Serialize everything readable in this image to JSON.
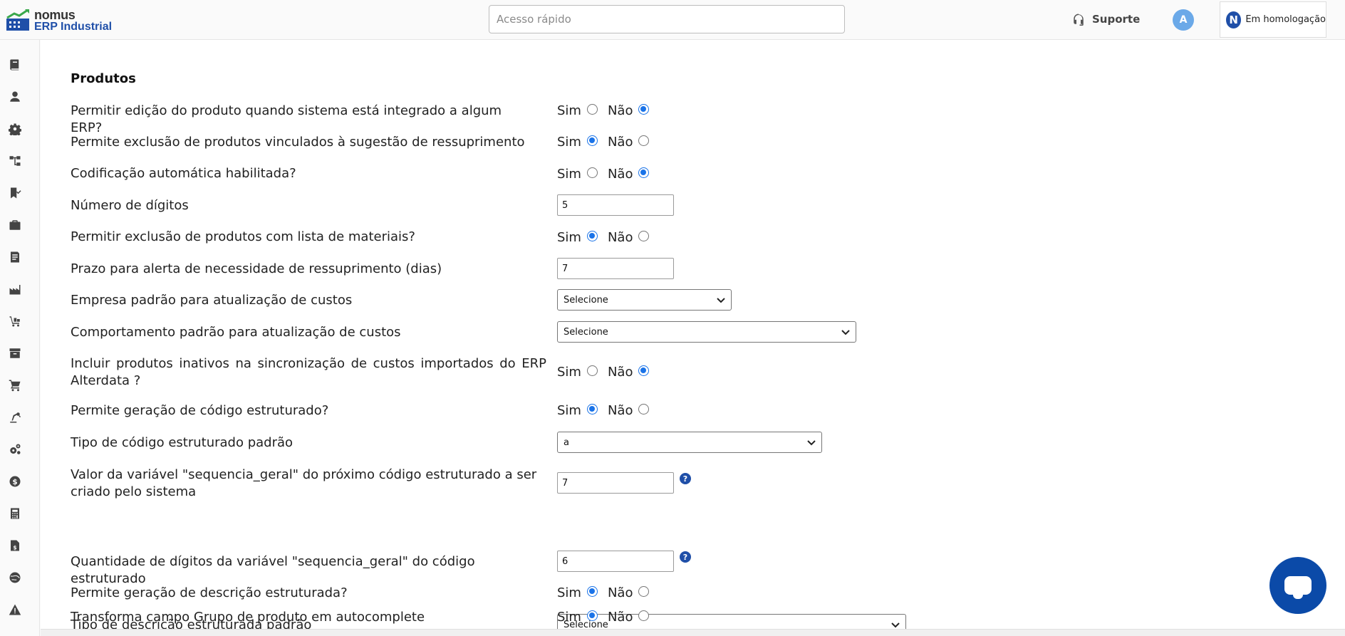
{
  "header": {
    "logo_name": "nomus",
    "logo_sub": "ERP Industrial",
    "quick_access_placeholder": "Acesso rápido",
    "support_label": "Suporte",
    "avatar_letter": "A",
    "environment_label": "Em homologação",
    "environment_logo_letter": "N"
  },
  "sidebar": {
    "icons": [
      "book-icon",
      "user-icon",
      "gear-icon",
      "sitemap-icon",
      "bookmark-check-icon",
      "briefcase-icon",
      "document-icon",
      "factory-icon",
      "dolly-icon",
      "archive-icon",
      "cart-icon",
      "robot-arm-icon",
      "cogs-icon",
      "dollar-icon",
      "calculator-icon",
      "invoice-icon",
      "globe-icon",
      "warning-icon"
    ]
  },
  "main": {
    "section_title": "Produtos",
    "yes_label": "Sim",
    "no_label": "Não",
    "rows": [
      {
        "label": "Permitir edição do produto quando sistema está integrado a algum ERP?",
        "type": "radio",
        "value": "Não"
      },
      {
        "label": "Permite exclusão de produtos vinculados à sugestão de ressuprimento",
        "type": "radio",
        "value": "Sim"
      },
      {
        "label": "Codificação automática habilitada?",
        "type": "radio",
        "value": "Não"
      },
      {
        "label": "Número de dígitos",
        "type": "text",
        "value": "5"
      },
      {
        "label": "Permitir exclusão de produtos com lista de materiais?",
        "type": "radio",
        "value": "Sim"
      },
      {
        "label": "Prazo para alerta de necessidade de ressuprimento (dias)",
        "type": "text",
        "value": "7"
      },
      {
        "label": "Empresa padrão para atualização de custos",
        "type": "select",
        "value": "Selecione"
      },
      {
        "label": "Comportamento padrão para atualização de custos",
        "type": "select",
        "value": "Selecione"
      },
      {
        "label": "Incluir produtos inativos na sincronização de custos importados do ERP Alterdata ?",
        "type": "radio",
        "value": "Não"
      },
      {
        "label": "Permite geração de código estruturado?",
        "type": "radio",
        "value": "Sim"
      },
      {
        "label": "Tipo de código estruturado padrão",
        "type": "select",
        "value": "a"
      },
      {
        "label": "Valor da variável \"sequencia_geral\" do próximo código estruturado a ser criado pelo sistema",
        "type": "text",
        "value": "7",
        "help": "?"
      },
      {
        "label": "Quantidade de dígitos da variável \"sequencia_geral\" do código estruturado",
        "type": "text",
        "value": "6",
        "help": "?"
      },
      {
        "label": "Permite geração de descrição estruturada?",
        "type": "radio",
        "value": "Sim"
      },
      {
        "label": "Tipo de descrição estruturada padrão",
        "type": "select",
        "value": "Selecione"
      },
      {
        "label": "Transforma campo Grupo de produto em autocomplete",
        "type": "radio",
        "value": "Sim"
      }
    ]
  },
  "colors": {
    "brand_blue": "#1f4fa8",
    "radio_blue": "#1a73e8",
    "chat_blue": "#0b4aa8"
  }
}
